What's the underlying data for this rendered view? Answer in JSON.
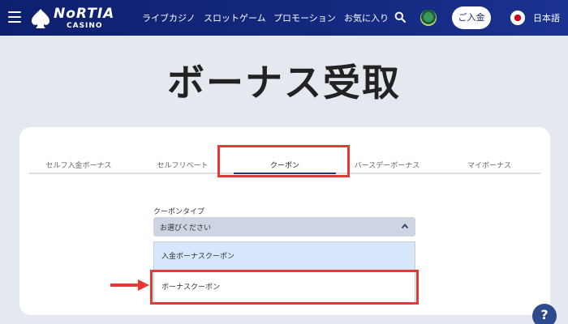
{
  "header": {
    "logo_text": "NoRTIA",
    "logo_sub": "CASINO",
    "nav": [
      "ライブカジノ",
      "スロットゲーム",
      "プロモーション",
      "お気に入り"
    ],
    "deposit_label": "ご入金",
    "language": "日本語"
  },
  "page": {
    "title": "ボーナス受取"
  },
  "tabs": [
    {
      "label": "セルフ入金ボーナス",
      "active": false
    },
    {
      "label": "セルフリベート",
      "active": false
    },
    {
      "label": "クーポン",
      "active": true
    },
    {
      "label": "バースデーボーナス",
      "active": false
    },
    {
      "label": "マイボーナス",
      "active": false
    }
  ],
  "form": {
    "field_label": "クーポンタイプ",
    "select_value": "お選びください",
    "options": [
      "入金ボーナスクーポン",
      "ボーナスクーポン"
    ]
  },
  "help": {
    "label": "?"
  },
  "colors": {
    "header": "#14297f",
    "highlight": "#e53935",
    "tab_underline": "#1d3a7a"
  }
}
